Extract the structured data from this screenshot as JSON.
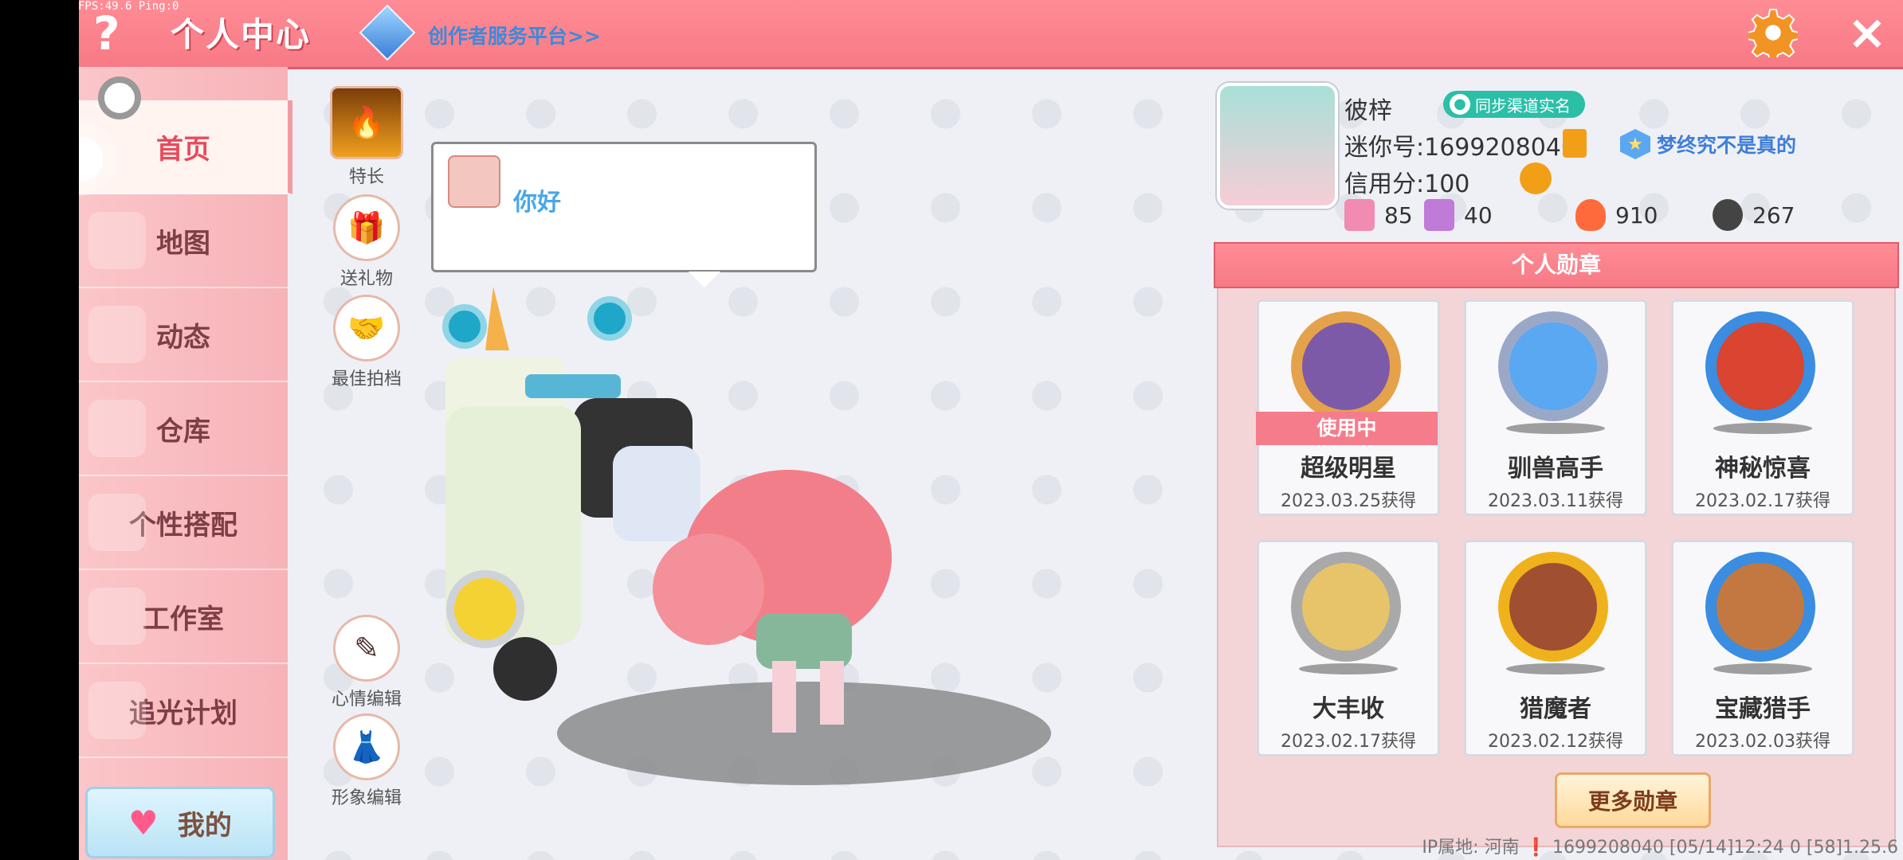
{
  "debug": {
    "fps": "FPS:49.6  Ping:0"
  },
  "topbar": {
    "help": "?",
    "title": "个人中心",
    "creator_link": "创作者服务平台>>",
    "close": "×"
  },
  "sidebar": {
    "items": [
      {
        "label": "首页",
        "active": true
      },
      {
        "label": "地图"
      },
      {
        "label": "动态"
      },
      {
        "label": "仓库"
      },
      {
        "label": "个性搭配"
      },
      {
        "label": "工作室"
      },
      {
        "label": "追光计划"
      }
    ],
    "mine": "我的"
  },
  "actions": {
    "special": "特长",
    "gift": "送礼物",
    "partner": "最佳拍档",
    "mood": "心情编辑",
    "appearance": "形象编辑"
  },
  "bubble": {
    "text": "你好"
  },
  "profile": {
    "name": "彼梓",
    "sync_label": "同步渠道实名",
    "mini_id": "迷你号:1699208040",
    "motto": "梦终究不是真的",
    "credit": "信用分:100",
    "stats": [
      "85",
      "40",
      "910",
      "267"
    ],
    "stat_colors": [
      "#f18bb2",
      "#c07ad8",
      "#ff6a3d",
      "#444444"
    ]
  },
  "medals": {
    "header": "个人勋章",
    "in_use": "使用中",
    "items": [
      {
        "name": "超级明星",
        "date": "2023.03.25获得",
        "color": "#e4a24a",
        "inner": "#7d5aa8"
      },
      {
        "name": "驯兽高手",
        "date": "2023.03.11获得",
        "color": "#9aa8c8",
        "inner": "#5aa7f2"
      },
      {
        "name": "神秘惊喜",
        "date": "2023.02.17获得",
        "color": "#3a8de0",
        "inner": "#d94530"
      },
      {
        "name": "大丰收",
        "date": "2023.02.17获得",
        "color": "#a9a9a9",
        "inner": "#e7c46a"
      },
      {
        "name": "猎魔者",
        "date": "2023.02.12获得",
        "color": "#f0b21c",
        "inner": "#a05030"
      },
      {
        "name": "宝藏猎手",
        "date": "2023.02.03获得",
        "color": "#3a8de0",
        "inner": "#c27840"
      }
    ],
    "more": "更多勋章"
  },
  "footer": "IP属地: 河南 ❗  1699208040  [05/14]12:24 0  [58]1.25.6"
}
